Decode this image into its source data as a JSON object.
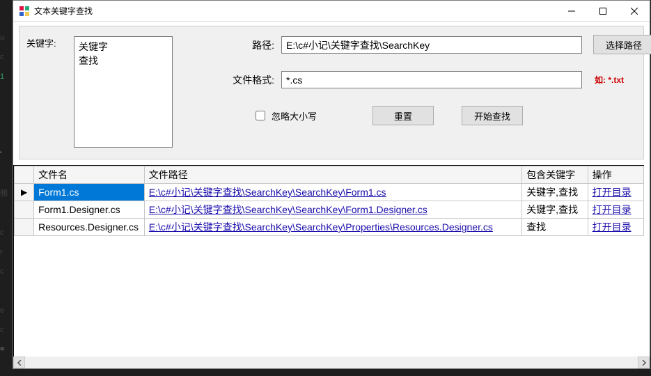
{
  "window": {
    "title": "文本关键字查找"
  },
  "form": {
    "keyword_label": "关键字:",
    "keyword_text": "关键字\n查找",
    "path_label": "路径:",
    "path_value": "E:\\c#小记\\关键字查找\\SearchKey",
    "select_path_btn": "选择路径",
    "ext_label": "文件格式:",
    "ext_value": "*.cs",
    "ext_hint": "如: *.txt",
    "ignore_case_label": "忽略大小写",
    "ignore_case_checked": false,
    "reset_btn": "重置",
    "search_btn": "开始查找"
  },
  "grid": {
    "headers": {
      "name": "文件名",
      "path": "文件路径",
      "keywords": "包含关键字",
      "action": "操作"
    },
    "action_label": "打开目录",
    "rows": [
      {
        "name": "Form1.cs",
        "path": "E:\\c#小记\\关键字查找\\SearchKey\\SearchKey\\Form1.cs",
        "keywords": "关键字,查找",
        "selected": true
      },
      {
        "name": "Form1.Designer.cs",
        "path": "E:\\c#小记\\关键字查找\\SearchKey\\SearchKey\\Form1.Designer.cs",
        "keywords": "关键字,查找",
        "selected": false
      },
      {
        "name": "Resources.Designer.cs",
        "path": "E:\\c#小记\\关键字查找\\SearchKey\\SearchKey\\Properties\\Resources.Designer.cs",
        "keywords": "查找",
        "selected": false
      }
    ]
  }
}
